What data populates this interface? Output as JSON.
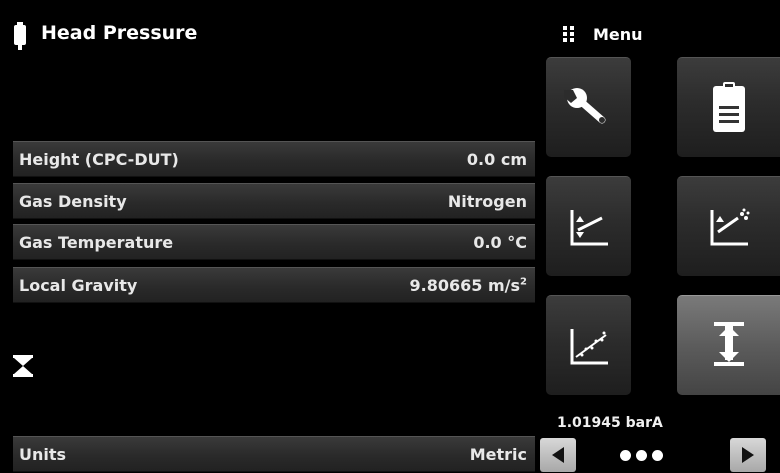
{
  "header": {
    "title": "Head Pressure",
    "icon": "cylinder-icon"
  },
  "menu": {
    "title": "Menu",
    "icon": "grid-dots-icon"
  },
  "rows": [
    {
      "label": "Height (CPC-DUT)",
      "value": "0.0 cm"
    },
    {
      "label": "Gas Density",
      "value": "Nitrogen"
    },
    {
      "label": "Gas Temperature",
      "value": "0.0 °C"
    },
    {
      "label": "Local Gravity",
      "value_main": "9.80665 m/s",
      "value_sup": "2"
    }
  ],
  "units": {
    "label": "Units",
    "value": "Metric"
  },
  "tiles": [
    {
      "icon": "wrench-icon"
    },
    {
      "icon": "clipboard-icon"
    },
    {
      "icon": "graph-arrows-icon"
    },
    {
      "icon": "graph-spray-icon"
    },
    {
      "icon": "graph-points-icon"
    },
    {
      "icon": "head-pressure-icon",
      "active": true
    }
  ],
  "status": {
    "pressure": "1.01945 barA"
  },
  "pagination": {
    "icon_prev": "arrow-left-icon",
    "icon_next": "arrow-right-icon",
    "pages": 3
  }
}
